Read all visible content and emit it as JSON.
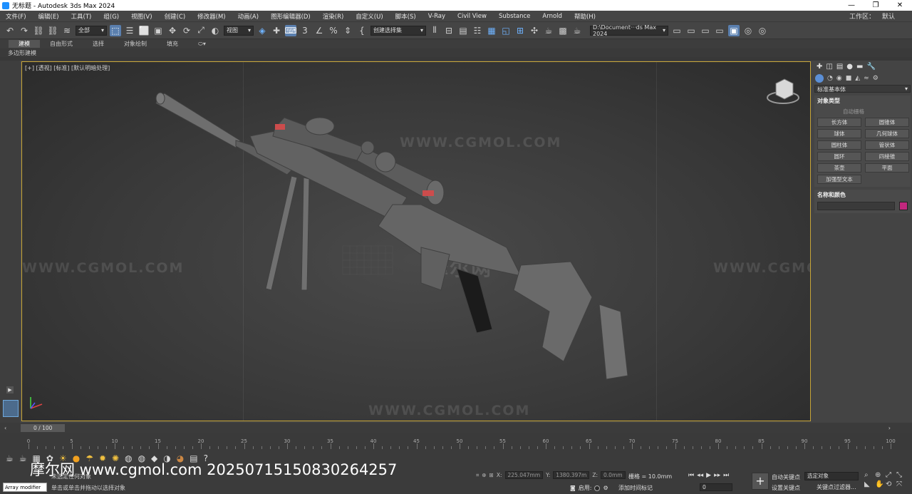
{
  "window": {
    "title": "无标题 - Autodesk 3ds Max 2024",
    "buttons": [
      "—",
      "❐",
      "✕"
    ]
  },
  "menu": {
    "items": [
      "文件(F)",
      "编辑(E)",
      "工具(T)",
      "组(G)",
      "视图(V)",
      "创建(C)",
      "修改器(M)",
      "动画(A)",
      "图形编辑器(D)",
      "渲染(R)",
      "自定义(U)",
      "脚本(S)",
      "V-Ray",
      "Civil View",
      "Substance",
      "Arnold",
      "帮助(H)"
    ],
    "workspace_label": "工作区：",
    "workspace_value": "默认"
  },
  "toolbar": {
    "selection_filter": "全部",
    "ref_coord": "视图",
    "named_selection": "创建选择集",
    "project_path": "D:\\Document···ds Max 2024"
  },
  "ribbon": {
    "tabs": [
      "建模",
      "自由形式",
      "选择",
      "对象绘制",
      "填充"
    ],
    "active_tab": "建模",
    "sub_label": "多边形建模"
  },
  "viewport": {
    "label": "[+] [透视] [标准] [默认明暗处理]",
    "watermark": "WWW.CGMOL.COM",
    "watermark_cn": "摩尔网"
  },
  "command_panel": {
    "category_dropdown": "标准基本体",
    "rollout_object_type": "对象类型",
    "autogrid": "自动栅格",
    "buttons": [
      "长方体",
      "圆锥体",
      "球体",
      "几何球体",
      "圆柱体",
      "管状体",
      "圆环",
      "四棱锥",
      "茶壶",
      "平面",
      "加强型文本"
    ],
    "rollout_name_color": "名称和颜色",
    "object_color": "#c3287e"
  },
  "timeline": {
    "frame_display": "0 / 100",
    "ticks": [
      "0",
      "5",
      "10",
      "15",
      "20",
      "25",
      "30",
      "35",
      "40",
      "45",
      "50",
      "55",
      "60",
      "65",
      "70",
      "75",
      "80",
      "85",
      "90",
      "95",
      "100"
    ]
  },
  "statusbar": {
    "watermark_text": "摩尔网 www.cgmol.com 20250715150830264257",
    "maxscript_listener": "Array modifier",
    "status_selection": "未选定任何对象",
    "status_prompt": "单击或单击并拖动以选择对象",
    "coord_x_label": "X:",
    "coord_x": "225.047mm",
    "coord_y_label": "Y:",
    "coord_y": "1380.397m",
    "coord_z_label": "Z:",
    "coord_z": "0.0mm",
    "grid": "栅格 = 10.0mm",
    "enable_label": "启用:",
    "add_time_tag": "添加时间标记",
    "frame_input": "0",
    "auto_key": "自动关键点",
    "set_key": "设置关键点",
    "selected_object_dropdown": "选定对象",
    "key_filter": "关键点过滤器..."
  }
}
